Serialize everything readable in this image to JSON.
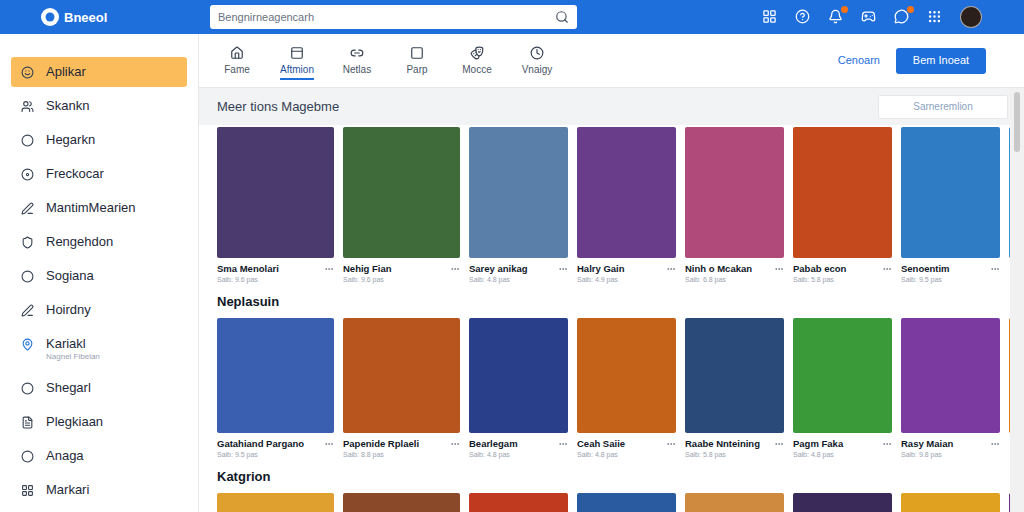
{
  "app": {
    "logo": "Bneeol"
  },
  "search": {
    "placeholder": "Bengnirneagencarh"
  },
  "toolbar": [
    {
      "badge": false
    },
    {
      "badge": false
    },
    {
      "badge": true
    },
    {
      "badge": false
    },
    {
      "badge": true
    },
    {
      "badge": false
    }
  ],
  "sidebar": {
    "items": [
      {
        "label": "Aplikar",
        "selected": true
      },
      {
        "label": "Skankn",
        "selected": false
      },
      {
        "label": "Hegarkn",
        "selected": false
      },
      {
        "label": "Freckocar",
        "selected": false
      },
      {
        "label": "MantimMearien",
        "selected": false
      },
      {
        "label": "Rengehdon",
        "selected": false
      },
      {
        "label": "Sogiana",
        "selected": false
      },
      {
        "label": "Hoirdny",
        "selected": false
      },
      {
        "label": "Kariakl",
        "sub": "Nagnel Fibelan",
        "selected": false
      },
      {
        "label": "Shegarl",
        "selected": false
      },
      {
        "label": "Plegkiaan",
        "selected": false
      },
      {
        "label": "Anaga",
        "selected": false
      },
      {
        "label": "Markari",
        "selected": false
      }
    ]
  },
  "tabs": [
    {
      "label": "Fame",
      "selected": false
    },
    {
      "label": "Aftmion",
      "selected": true
    },
    {
      "label": "Netlas",
      "selected": false
    },
    {
      "label": "Parp",
      "selected": false
    },
    {
      "label": "Mocce",
      "selected": false
    },
    {
      "label": "Vnaigy",
      "selected": false
    }
  ],
  "actions": {
    "link": "Cenoarn",
    "button": "Bem Inoeat"
  },
  "filter": {
    "placeholder": "Sarneremlion"
  },
  "sections": [
    {
      "title": "Meer tions Magebme",
      "games": [
        {
          "title": "Sma Menolari",
          "meta": "Saib: 9.6 pas",
          "color": "#4a3a6e"
        },
        {
          "title": "Nehig Fian",
          "meta": "Saib: 9.6 pas",
          "color": "#3f6a3a"
        },
        {
          "title": "Sarey anikag",
          "meta": "Saib: 4.8 pas",
          "color": "#5a7fa8"
        },
        {
          "title": "Halry Gain",
          "meta": "Saib: 4.9 pas",
          "color": "#6a3d8a"
        },
        {
          "title": "Ninh o Mcakan",
          "meta": "Saib: 6.8 pas",
          "color": "#b04a7a"
        },
        {
          "title": "Pabab econ",
          "meta": "Saib: 5.8 pas",
          "color": "#c44a1e"
        },
        {
          "title": "Senoentim",
          "meta": "Saib: 9.5 pas",
          "color": "#2f7bc4"
        },
        {
          "title": "",
          "meta": "",
          "color": "#3a8fd0"
        }
      ]
    },
    {
      "title": "Neplasuin",
      "games": [
        {
          "title": "Gatahiand Pargano",
          "meta": "Saib: 9.5 pas",
          "color": "#3a5fb0"
        },
        {
          "title": "Papenide Rplaeli",
          "meta": "Saib: 8.8 pas",
          "color": "#b8541e"
        },
        {
          "title": "Bearlegam",
          "meta": "Saib: 4.8 pas",
          "color": "#2a3f8a"
        },
        {
          "title": "Ceah Saiie",
          "meta": "Saib: 4.8 pas",
          "color": "#c4621a"
        },
        {
          "title": "Raabe Nnteining",
          "meta": "Saib: 5.8 pas",
          "color": "#2a4a7a"
        },
        {
          "title": "Pagm Faka",
          "meta": "Saib: 4.8 pas",
          "color": "#3a9a3a"
        },
        {
          "title": "Rasy Maian",
          "meta": "Saib: 9.8 pas",
          "color": "#7a3aa0"
        },
        {
          "title": "",
          "meta": "",
          "color": "#e07a1a"
        }
      ]
    },
    {
      "title": "Katgrion",
      "games": [
        {
          "title": "",
          "meta": "",
          "color": "#e0a030"
        },
        {
          "title": "",
          "meta": "",
          "color": "#8a4a2a"
        },
        {
          "title": "",
          "meta": "",
          "color": "#c03a20"
        },
        {
          "title": "",
          "meta": "",
          "color": "#2a5aa0"
        },
        {
          "title": "",
          "meta": "",
          "color": "#d08a40"
        },
        {
          "title": "",
          "meta": "",
          "color": "#3a2a5a"
        },
        {
          "title": "",
          "meta": "",
          "color": "#e0a020"
        },
        {
          "title": "",
          "meta": "",
          "color": "#6a2a8a"
        }
      ]
    }
  ]
}
